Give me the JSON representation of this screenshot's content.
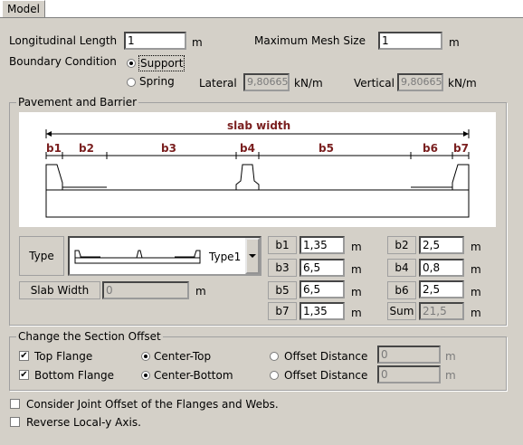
{
  "tab": {
    "label": "Model"
  },
  "longitudinal": {
    "label": "Longitudinal Length",
    "value": "1",
    "unit": "m"
  },
  "mesh": {
    "label": "Maximum Mesh Size",
    "value": "1",
    "unit": "m"
  },
  "boundary": {
    "label": "Boundary Condition",
    "support_label": "Support",
    "spring_label": "Spring",
    "selected": "Support",
    "lateral_label": "Lateral",
    "lateral_value": "9,80665",
    "lateral_unit": "kN/m",
    "vertical_label": "Vertical",
    "vertical_value": "9,80665",
    "vertical_unit": "kN/m"
  },
  "pavement": {
    "title": "Pavement and Barrier",
    "diagram": {
      "slab_label": "slab width",
      "parts": [
        "b1",
        "b2",
        "b3",
        "b4",
        "b5",
        "b6",
        "b7"
      ]
    },
    "type_label": "Type",
    "type_value": "Type1",
    "slab_width_label": "Slab Width",
    "slab_width_value": "0",
    "slab_width_unit": "m",
    "fields": [
      {
        "name": "b1",
        "value": "1,35",
        "unit": "m"
      },
      {
        "name": "b2",
        "value": "2,5",
        "unit": "m"
      },
      {
        "name": "b3",
        "value": "6,5",
        "unit": "m"
      },
      {
        "name": "b4",
        "value": "0,8",
        "unit": "m"
      },
      {
        "name": "b5",
        "value": "6,5",
        "unit": "m"
      },
      {
        "name": "b6",
        "value": "2,5",
        "unit": "m"
      },
      {
        "name": "b7",
        "value": "1,35",
        "unit": "m"
      },
      {
        "name": "Sum",
        "value": "21,5",
        "unit": "m"
      }
    ]
  },
  "offset": {
    "title": "Change the Section Offset",
    "top_flange": {
      "label": "Top Flange",
      "checked": true,
      "center": "Center-Top",
      "distance_label": "Offset Distance",
      "distance_value": "0",
      "unit": "m"
    },
    "bottom_flange": {
      "label": "Bottom Flange",
      "checked": true,
      "center": "Center-Bottom",
      "distance_label": "Offset Distance",
      "distance_value": "0",
      "unit": "m"
    }
  },
  "options": {
    "joint_offset": "Consider Joint Offset of the Flanges and Webs.",
    "reverse_axis": "Reverse Local-y Axis."
  }
}
